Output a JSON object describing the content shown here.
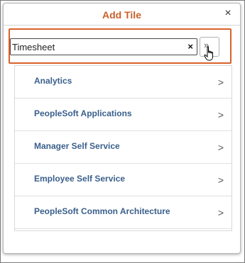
{
  "dialog": {
    "title": "Add Tile",
    "close_label": "×"
  },
  "search": {
    "value": "Timesheet",
    "clear_label": "×",
    "go_label": "»"
  },
  "list": {
    "items": [
      {
        "label": "Analytics",
        "chevron": ">"
      },
      {
        "label": "PeopleSoft Applications",
        "chevron": ">"
      },
      {
        "label": "Manager Self Service",
        "chevron": ">"
      },
      {
        "label": "Employee Self Service",
        "chevron": ">"
      },
      {
        "label": "PeopleSoft Common Architecture",
        "chevron": ">"
      }
    ]
  },
  "colors": {
    "title": "#c9602a",
    "highlight_border": "#d9622b",
    "item_text": "#3a5f8c"
  }
}
